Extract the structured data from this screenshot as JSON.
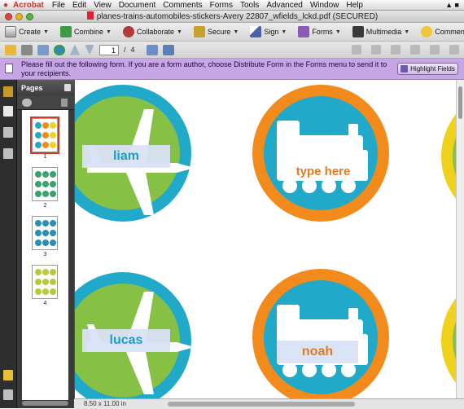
{
  "menubar": {
    "app_name": "Acrobat",
    "items": [
      "File",
      "Edit",
      "View",
      "Document",
      "Comments",
      "Forms",
      "Tools",
      "Advanced",
      "Window",
      "Help"
    ]
  },
  "window": {
    "title": "planes-trains-automobiles-stickers-Avery 22807_wfields_lckd.pdf (SECURED)"
  },
  "toolbar": {
    "create": "Create",
    "combine": "Combine",
    "collaborate": "Collaborate",
    "secure": "Secure",
    "sign": "Sign",
    "forms": "Forms",
    "multimedia": "Multimedia",
    "comment": "Comment"
  },
  "navigation": {
    "current_page": "1",
    "separator": "/",
    "total_pages": "4"
  },
  "banner": {
    "message": "Please fill out the following form. If you are a form author, choose Distribute Form in the Forms menu to send it to your recipients.",
    "highlight_label": "Highlight Fields"
  },
  "pages_panel": {
    "title": "Pages",
    "thumbnails": [
      {
        "label": "1",
        "selected": true
      },
      {
        "label": "2",
        "selected": false
      },
      {
        "label": "3",
        "selected": false
      },
      {
        "label": "4",
        "selected": false
      }
    ]
  },
  "document": {
    "fields": {
      "plane1": "liam",
      "train1": "type here",
      "plane2": "lucas",
      "train2": "noah"
    }
  },
  "statusbar": {
    "page_size": "8.50 x 11.00 in"
  },
  "colors": {
    "blue_ring": "#20a9c9",
    "green_fill": "#86c044",
    "orange_ring": "#f38a1c",
    "yellow_ring": "#f0d21c",
    "label_text_blue": "#1a9fcb",
    "label_text_orange": "#e07b20",
    "banner": "#c7a6e6"
  },
  "icons": [
    "apple-icon",
    "pdf-file-icon",
    "create-icon",
    "combine-icon",
    "collaborate-icon",
    "secure-icon",
    "sign-icon",
    "forms-icon",
    "multimedia-icon",
    "comment-icon",
    "open-icon",
    "print-icon",
    "email-icon",
    "search-icon",
    "prev-page-icon",
    "next-page-icon",
    "fit-page-icon",
    "full-screen-icon",
    "select-tool-icon",
    "hand-tool-icon",
    "zoom-tool-icon",
    "lock-icon",
    "pages-icon",
    "bookmarks-icon",
    "signatures-icon",
    "comments-icon",
    "attachments-icon",
    "gear-icon",
    "trash-icon"
  ]
}
